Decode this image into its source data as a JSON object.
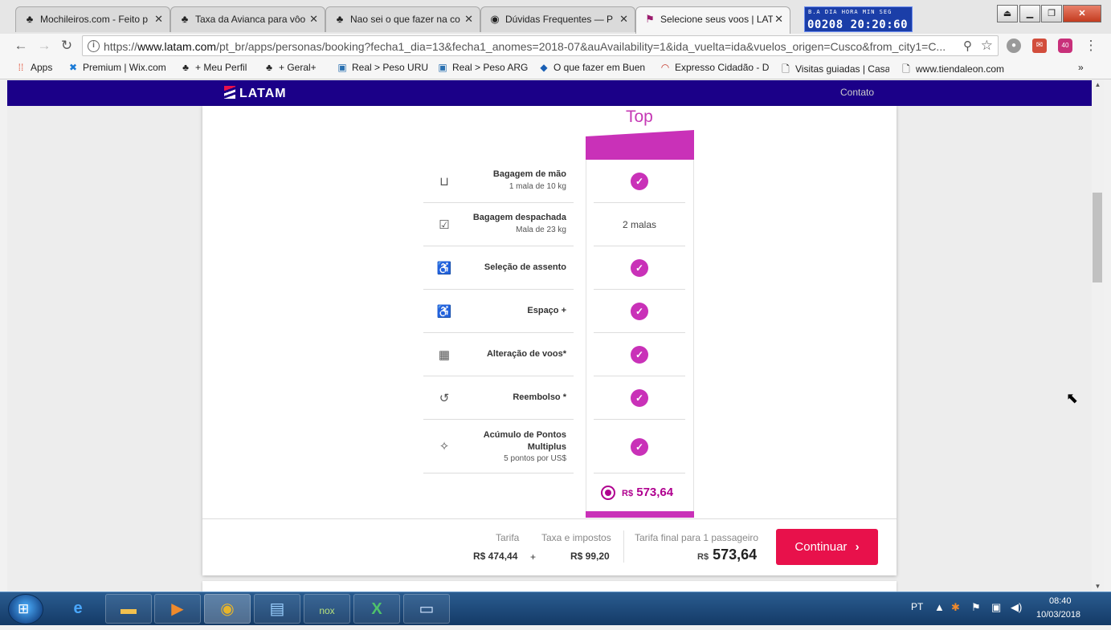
{
  "tabs": [
    {
      "title": "Mochileiros.com - Feito p",
      "icon": "tree-icon"
    },
    {
      "title": "Taxa da Avianca para vôo",
      "icon": "tree-icon"
    },
    {
      "title": "Nao sei o que fazer na co",
      "icon": "tree-icon"
    },
    {
      "title": "Dúvidas Frequentes — P",
      "icon": "globe-icon"
    },
    {
      "title": "Selecione seus voos | LAT",
      "icon": "latam-icon"
    }
  ],
  "clock": {
    "top": "B.A   DIA     HORA  MIN   SEG",
    "bottom": "00208 20:20:60"
  },
  "toolbar": {
    "url_scheme": "https://",
    "url_host": "www.latam.com",
    "url_rest": "/pt_br/apps/personas/booking?fecha1_dia=13&fecha1_anomes=2018-07&auAvailability=1&ida_vuelta=ida&vuelos_origen=Cusco&from_city1=C...",
    "ext_badge": "40"
  },
  "bookmarks": [
    {
      "label": "Apps",
      "icon": "apps-grid-icon"
    },
    {
      "label": "Premium | Wix.com",
      "icon": "wix-icon"
    },
    {
      "label": "+ Meu Perfil",
      "icon": "tree-icon"
    },
    {
      "label": "+ Geral+",
      "icon": "tree-icon"
    },
    {
      "label": "Real > Peso URU",
      "icon": "currency-icon"
    },
    {
      "label": "Real > Peso ARG",
      "icon": "currency-icon"
    },
    {
      "label": "O que fazer em Buen",
      "icon": "map-pin-icon"
    },
    {
      "label": "Expresso Cidadão - D",
      "icon": "rainbow-icon"
    },
    {
      "label": "Visitas guiadas | Casa",
      "icon": "page-icon"
    },
    {
      "label": "www.tiendaleon.com",
      "icon": "page-icon"
    }
  ],
  "latam": {
    "logo": "LATAM",
    "contact": "Contato"
  },
  "fare": {
    "column_title": "Top",
    "features": [
      {
        "title": "Bagagem de mão",
        "sub": "1 mala de 10 kg",
        "icon": "carry-on-bag-icon",
        "value_type": "check",
        "value": ""
      },
      {
        "title": "Bagagem despachada",
        "sub": "Mala de 23 kg",
        "icon": "checked-bag-icon",
        "value_type": "text",
        "value": "2 malas"
      },
      {
        "title": "Seleção de assento",
        "sub": "",
        "icon": "seat-icon",
        "value_type": "check",
        "value": ""
      },
      {
        "title": "Espaço +",
        "sub": "",
        "icon": "seat-space-icon",
        "value_type": "check",
        "value": ""
      },
      {
        "title": "Alteração de voos*",
        "sub": "",
        "icon": "calendar-icon",
        "value_type": "check",
        "value": ""
      },
      {
        "title": "Reembolso *",
        "sub": "",
        "icon": "refund-icon",
        "value_type": "check",
        "value": ""
      },
      {
        "title": "Acúmulo de Pontos Multiplus",
        "sub": "5 pontos por US$",
        "icon": "points-icon",
        "value_type": "check",
        "value": ""
      }
    ],
    "currency": "R$",
    "price": "573,64"
  },
  "footer": {
    "tarifa_label": "Tarifa",
    "tarifa_value": "R$ 474,44",
    "plus": "+",
    "taxa_label": "Taxa e impostos",
    "taxa_value": "R$ 99,20",
    "final_label": "Tarifa final para 1 passageiro",
    "final_currency": "R$",
    "final_value": "573,64",
    "continue_label": "Continuar"
  },
  "taskbar": {
    "items": [
      "ie-icon",
      "folder-icon",
      "media-player-icon",
      "chrome-icon",
      "control-panel-icon",
      "nox-icon",
      "excel-icon",
      "remote-desktop-icon"
    ],
    "lang": "PT",
    "time": "08:40",
    "date": "10/03/2018"
  },
  "colors": {
    "latam_navy": "#1b0088",
    "top_magenta": "#c931b8",
    "continue_red": "#e8114b"
  }
}
